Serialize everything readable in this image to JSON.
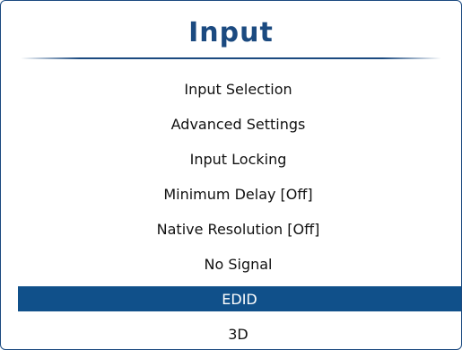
{
  "menu": {
    "title": "Input",
    "items": [
      {
        "label": "Input Selection",
        "selected": false
      },
      {
        "label": "Advanced Settings",
        "selected": false
      },
      {
        "label": "Input Locking",
        "selected": false
      },
      {
        "label": "Minimum Delay [Off]",
        "selected": false
      },
      {
        "label": "Native Resolution [Off]",
        "selected": false
      },
      {
        "label": "No Signal",
        "selected": false
      },
      {
        "label": "EDID",
        "selected": true
      },
      {
        "label": "3D",
        "selected": false
      }
    ]
  },
  "colors": {
    "accent": "#1b4a80",
    "selection": "#10508a",
    "text": "#111111"
  }
}
